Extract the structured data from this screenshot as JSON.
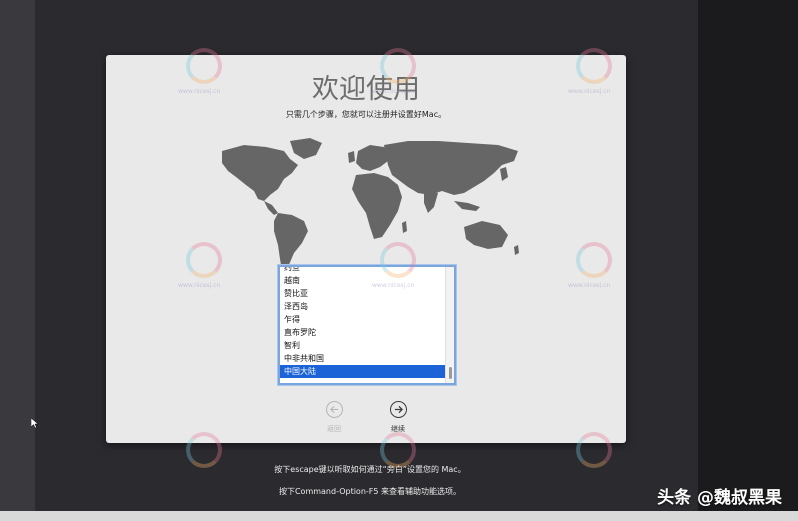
{
  "window": {
    "title": "欢迎使用",
    "subtitle": "只需几个步骤，您就可以注册并设置好Mac。"
  },
  "country_list": {
    "items": [
      {
        "label": "约旦",
        "selected": false
      },
      {
        "label": "越南",
        "selected": false
      },
      {
        "label": "赞比亚",
        "selected": false
      },
      {
        "label": "泽西岛",
        "selected": false
      },
      {
        "label": "乍得",
        "selected": false
      },
      {
        "label": "直布罗陀",
        "selected": false
      },
      {
        "label": "智利",
        "selected": false
      },
      {
        "label": "中非共和国",
        "selected": false
      },
      {
        "label": "中国大陆",
        "selected": true
      }
    ]
  },
  "navigation": {
    "back_label": "返回",
    "next_label": "继续"
  },
  "hints": {
    "line1": "按下escape键以听取如何通过“旁白”设置您的 Mac。",
    "line2": "按下Command-Option-F5 来查看辅助功能选项。"
  },
  "watermark": {
    "text": "www.nicesj.cn"
  },
  "credit": "头条 @魏叔黑果",
  "colors": {
    "selection": "#1b63d6",
    "window_bg": "#e9e9e9",
    "desktop_bg": "#2b2a2f"
  }
}
